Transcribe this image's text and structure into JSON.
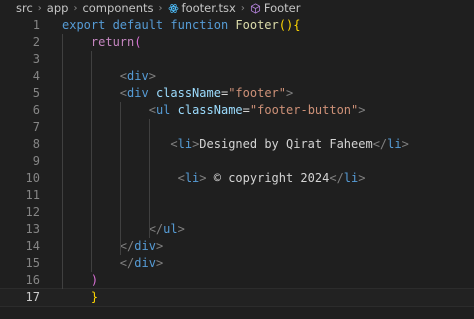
{
  "breadcrumb": {
    "items": [
      "src",
      "app",
      "components",
      "footer.tsx",
      "Footer"
    ],
    "icons": [
      "chevron-right",
      "react-icon",
      "symbol-cube-icon"
    ]
  },
  "editor": {
    "active_line": 17,
    "lines": [
      {
        "n": "1",
        "tokens": [
          [
            "kw",
            "export "
          ],
          [
            "kw",
            "default "
          ],
          [
            "kw",
            "function "
          ],
          [
            "fn",
            "Footer"
          ],
          [
            "p1",
            "()"
          ],
          [
            "p1",
            "{"
          ]
        ]
      },
      {
        "n": "2",
        "tokens": [
          [
            "txt",
            "    "
          ],
          [
            "kw2",
            "return"
          ],
          [
            "p2",
            "("
          ]
        ]
      },
      {
        "n": "3",
        "tokens": []
      },
      {
        "n": "4",
        "tokens": [
          [
            "txt",
            "        "
          ],
          [
            "bracket",
            "<"
          ],
          [
            "tag",
            "div"
          ],
          [
            "bracket",
            ">"
          ]
        ]
      },
      {
        "n": "5",
        "tokens": [
          [
            "txt",
            "        "
          ],
          [
            "bracket",
            "<"
          ],
          [
            "tag",
            "div "
          ],
          [
            "attr",
            "className"
          ],
          [
            "txt",
            "="
          ],
          [
            "str",
            "\"footer\""
          ],
          [
            "bracket",
            ">"
          ]
        ]
      },
      {
        "n": "6",
        "tokens": [
          [
            "txt",
            "            "
          ],
          [
            "bracket",
            "<"
          ],
          [
            "tag",
            "ul "
          ],
          [
            "attr",
            "className"
          ],
          [
            "txt",
            "="
          ],
          [
            "str",
            "\"footer-button\""
          ],
          [
            "bracket",
            ">"
          ]
        ]
      },
      {
        "n": "7",
        "tokens": []
      },
      {
        "n": "8",
        "tokens": [
          [
            "txt",
            "               "
          ],
          [
            "bracket",
            "<"
          ],
          [
            "tag",
            "li"
          ],
          [
            "bracket",
            ">"
          ],
          [
            "txt",
            "Designed by Qirat Faheem"
          ],
          [
            "bracket",
            "</"
          ],
          [
            "tag",
            "li"
          ],
          [
            "bracket",
            ">"
          ]
        ]
      },
      {
        "n": "9",
        "tokens": []
      },
      {
        "n": "10",
        "tokens": [
          [
            "txt",
            "                "
          ],
          [
            "bracket",
            "<"
          ],
          [
            "tag",
            "li"
          ],
          [
            "bracket",
            ">"
          ],
          [
            "txt",
            " © copyright 2024"
          ],
          [
            "bracket",
            "</"
          ],
          [
            "tag",
            "li"
          ],
          [
            "bracket",
            ">"
          ]
        ]
      },
      {
        "n": "11",
        "tokens": []
      },
      {
        "n": "12",
        "tokens": []
      },
      {
        "n": "13",
        "tokens": [
          [
            "txt",
            "            "
          ],
          [
            "bracket",
            "</"
          ],
          [
            "tag",
            "ul"
          ],
          [
            "bracket",
            ">"
          ]
        ]
      },
      {
        "n": "14",
        "tokens": [
          [
            "txt",
            "        "
          ],
          [
            "bracket",
            "</"
          ],
          [
            "tag",
            "div"
          ],
          [
            "bracket",
            ">"
          ]
        ]
      },
      {
        "n": "15",
        "tokens": [
          [
            "txt",
            "        "
          ],
          [
            "bracket",
            "</"
          ],
          [
            "tag",
            "div"
          ],
          [
            "bracket",
            ">"
          ]
        ]
      },
      {
        "n": "16",
        "tokens": [
          [
            "txt",
            "    "
          ],
          [
            "p2",
            ")"
          ]
        ]
      },
      {
        "n": "17",
        "tokens": [
          [
            "txt",
            "    "
          ],
          [
            "p1",
            "}"
          ]
        ]
      }
    ]
  }
}
